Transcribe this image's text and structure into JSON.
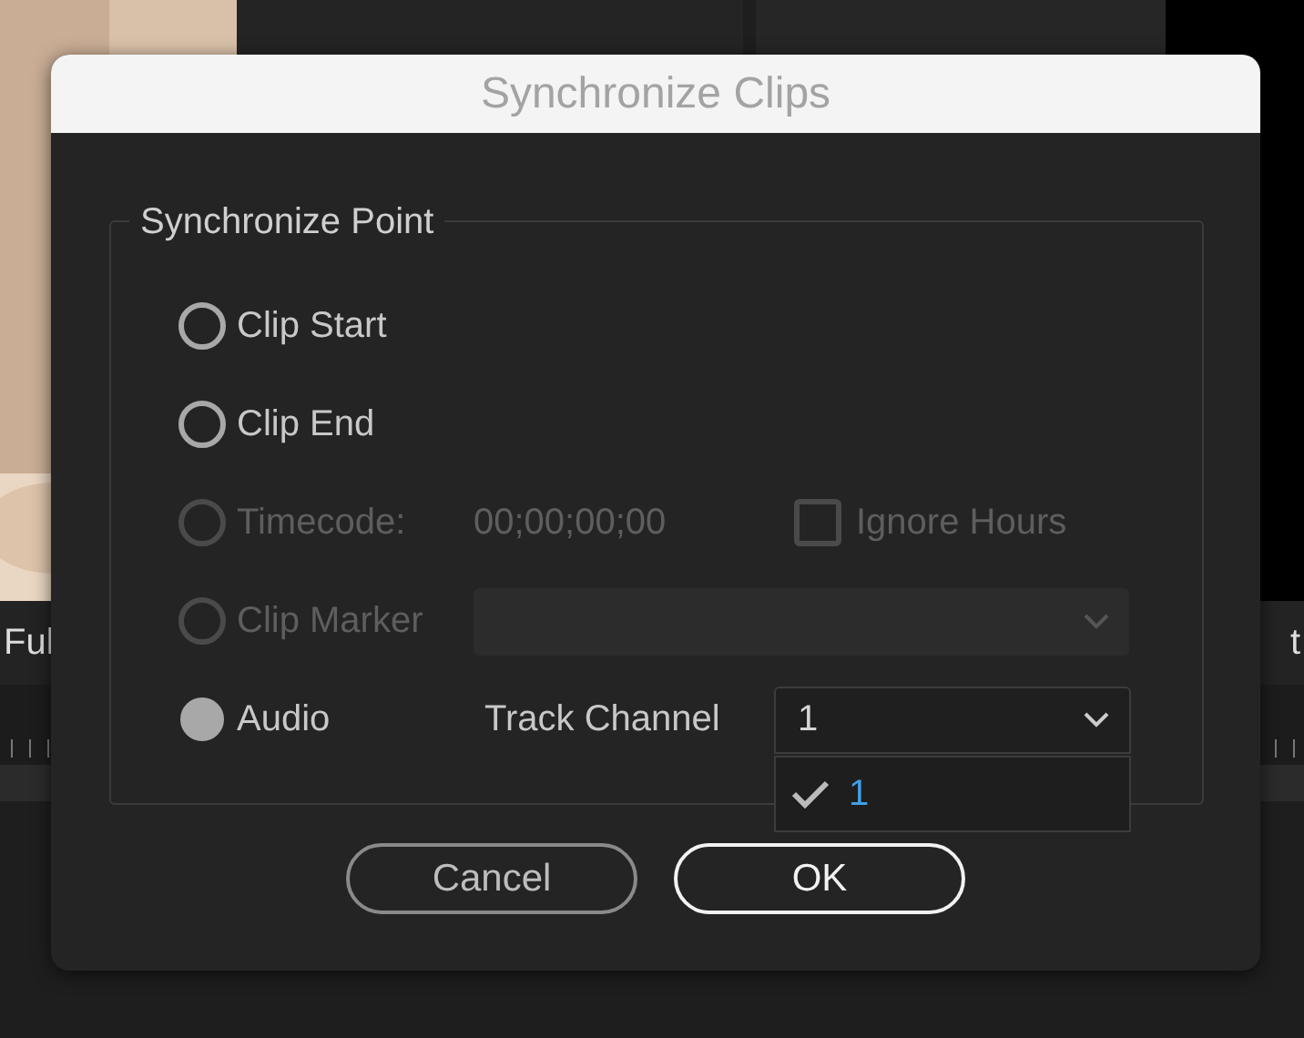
{
  "background": {
    "left_label": "Ful",
    "right_label": "t"
  },
  "dialog": {
    "title": "Synchronize Clips",
    "group_title": "Synchronize Point",
    "options": [
      {
        "kind": "plain",
        "label": "Clip Start",
        "selected": false,
        "disabled": false
      },
      {
        "kind": "plain",
        "label": "Clip End",
        "selected": false,
        "disabled": false
      },
      {
        "kind": "timecode",
        "label": "Timecode:",
        "selected": false,
        "disabled": true,
        "value": "00;00;00;00",
        "checkbox": {
          "label": "Ignore Hours",
          "checked": false,
          "disabled": true
        }
      },
      {
        "kind": "marker",
        "label": "Clip Marker",
        "selected": false,
        "disabled": true,
        "dropdown": {
          "disabled": true
        }
      },
      {
        "kind": "channel",
        "label": "Audio",
        "selected": true,
        "disabled": false,
        "field_label": "Track Channel",
        "dropdown": {
          "value": "1",
          "disabled": false,
          "expanded": true,
          "items": [
            {
              "label": "1",
              "selected": true
            }
          ]
        }
      }
    ],
    "buttons": [
      {
        "label": "Cancel",
        "default": false
      },
      {
        "label": "OK",
        "default": true
      }
    ]
  }
}
